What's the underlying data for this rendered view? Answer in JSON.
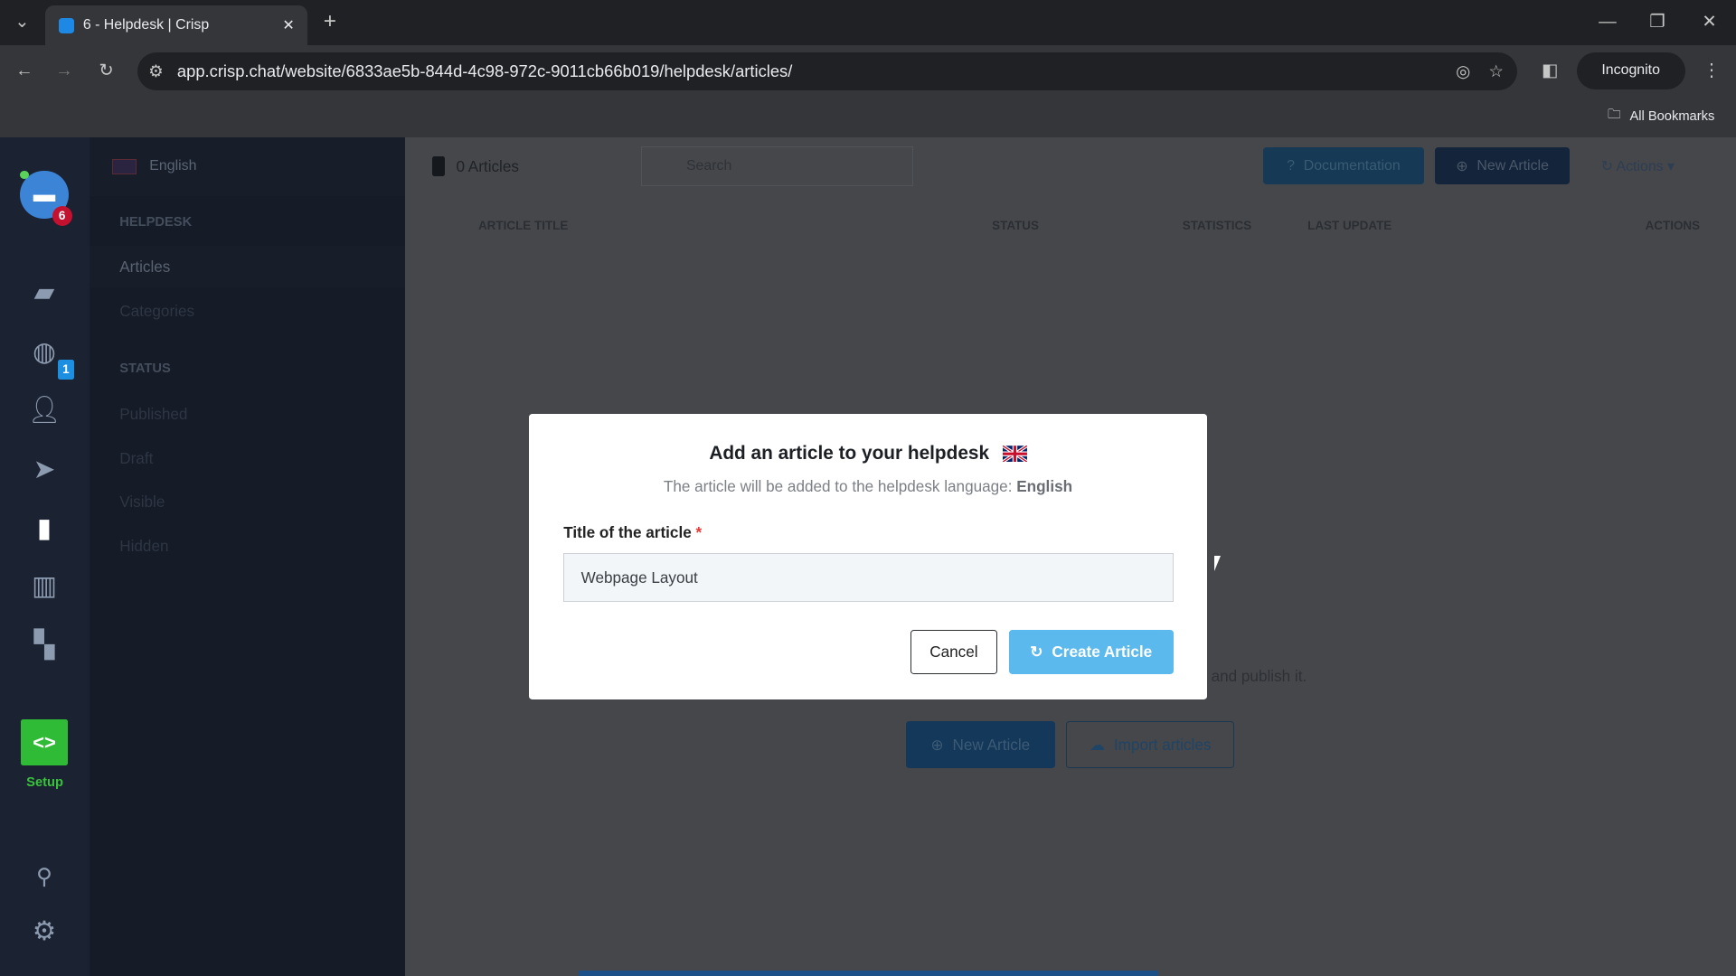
{
  "browser": {
    "tab_title": "6 - Helpdesk | Crisp",
    "url": "app.crisp.chat/website/6833ae5b-844d-4c98-972c-9011cb66b019/helpdesk/articles/",
    "incognito_label": "Incognito",
    "bookmarks_label": "All Bookmarks"
  },
  "rail": {
    "unread_badge": "6",
    "globe_badge": "1",
    "setup_label": "Setup",
    "accent": "#3ec83e"
  },
  "sidebar": {
    "language": "English",
    "helpdesk_heading": "HELPDESK",
    "helpdesk_items": [
      "Articles",
      "Categories"
    ],
    "status_heading": "STATUS",
    "status_items": [
      "Published",
      "Draft",
      "Visible",
      "Hidden"
    ]
  },
  "main": {
    "count": "0 Articles",
    "search_placeholder": "Search",
    "documentation": "Documentation",
    "new_article": "New Article",
    "actions": "Actions",
    "columns": [
      "ARTICLE TITLE",
      "STATUS",
      "STATISTICS",
      "LAST UPDATE",
      "ACTIONS"
    ],
    "empty_text": "and publish it.",
    "empty_new_article": "New Article",
    "import_articles": "Import articles"
  },
  "modal": {
    "title": "Add an article to your helpdesk",
    "subtitle": "The article will be added to the helpdesk language:",
    "language": "English",
    "field_label": "Title of the article",
    "required_mark": "*",
    "field_value": "Webpage Layout",
    "cancel": "Cancel",
    "create": "Create Article",
    "create_color": "#5bb9ee"
  }
}
